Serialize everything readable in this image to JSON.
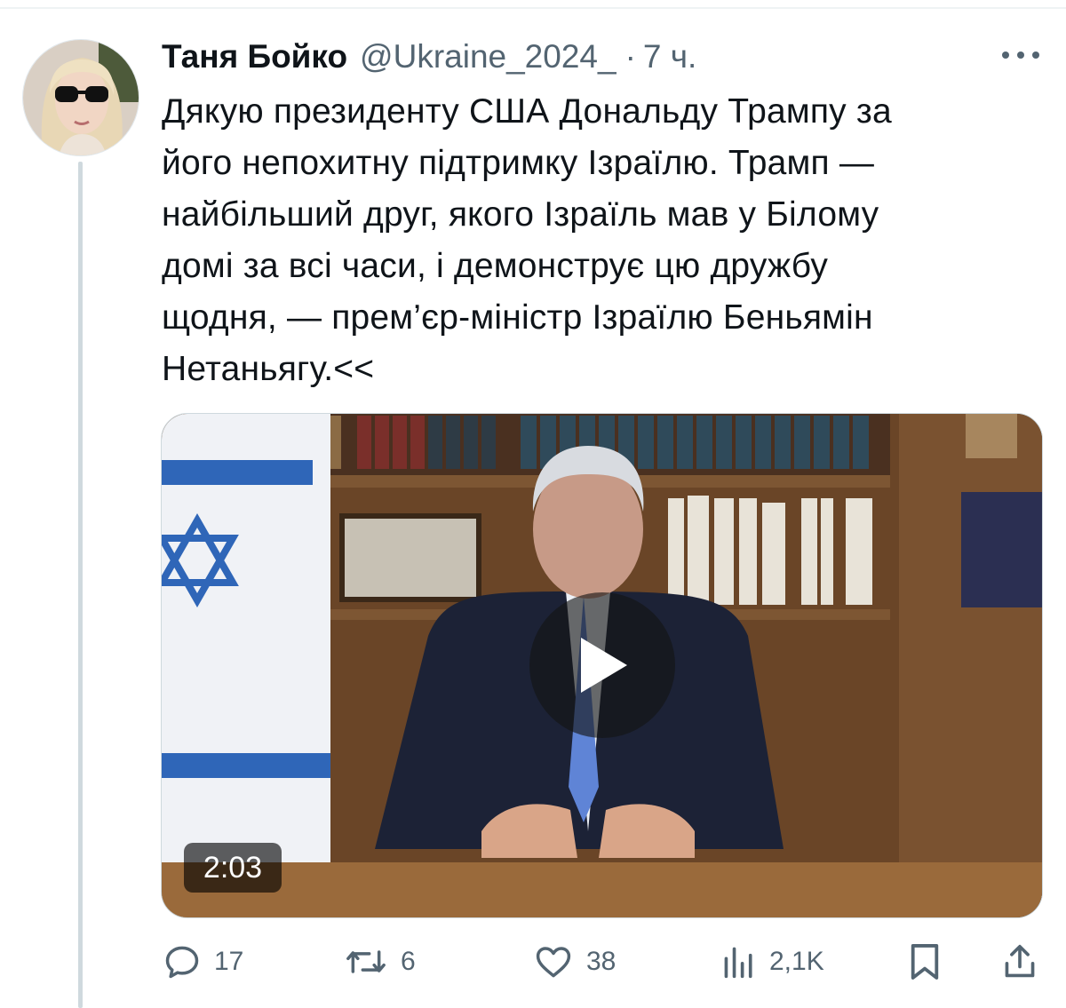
{
  "author": {
    "display_name": "Таня Бойко",
    "handle": "@Ukraine_2024_",
    "separator": "·",
    "time": "7 ч."
  },
  "tweet": {
    "text": "Дякую президенту США Дональду Трампу за\nйого непохитну підтримку Ізраїлю. Трамп —\nнайбільший друг, якого Ізраїль мав у Білому\nдомі за всі часи, і демонструє цю дружбу\nщодня, — прем’єр-міністр Ізраїлю Беньямін\nНетаньягу.<<"
  },
  "media": {
    "type": "video",
    "duration": "2:03"
  },
  "actions": {
    "replies": "17",
    "retweets": "6",
    "likes": "38",
    "views": "2,1K"
  },
  "icons": {
    "more": "more-horizontal-icon",
    "reply": "reply-bubble-icon",
    "retweet": "retweet-icon",
    "like": "heart-icon",
    "views": "bar-chart-icon",
    "bookmark": "bookmark-icon",
    "share": "share-icon",
    "play": "play-icon"
  },
  "colors": {
    "text": "#0f1419",
    "secondary": "#536471",
    "thread_line": "#cfd9de"
  }
}
